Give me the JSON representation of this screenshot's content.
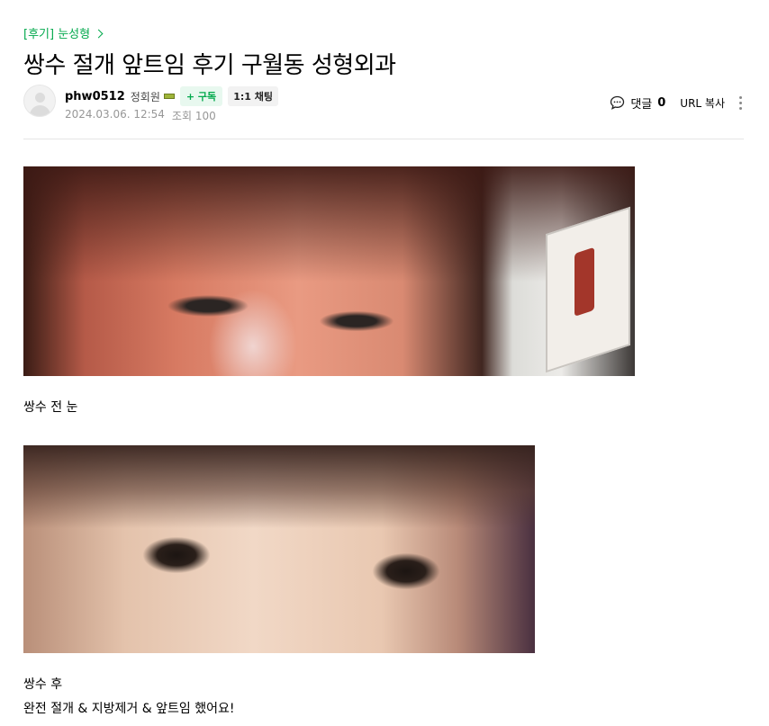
{
  "article": {
    "category_label": "[후기] 눈성형",
    "title": "쌍수 절개 앞트임 후기 구월동 성형외과"
  },
  "writer": {
    "nickname": "phw0512",
    "grade": "정회원",
    "subscribe_label": "+ 구독",
    "chat_label": "1:1 채팅",
    "date": "2024.03.06. 12:54",
    "views_label": "조회 100"
  },
  "tools": {
    "comment_label": "댓글",
    "comment_count": "0",
    "url_copy_label": "URL 복사"
  },
  "content": {
    "caption_before": "쌍수 전 눈",
    "caption_after": "쌍수 후",
    "caption_detail": "완전 절개 & 지방제거 & 앞트임 했어요!"
  },
  "colors": {
    "accent": "#03a94d",
    "meta_text": "#979797",
    "divider": "#e5e5e5"
  },
  "icons": {
    "comment": "speech-bubble-icon",
    "more": "vertical-ellipsis-icon",
    "category_arrow": "chevron-right-icon",
    "avatar": "default-avatar-icon"
  }
}
